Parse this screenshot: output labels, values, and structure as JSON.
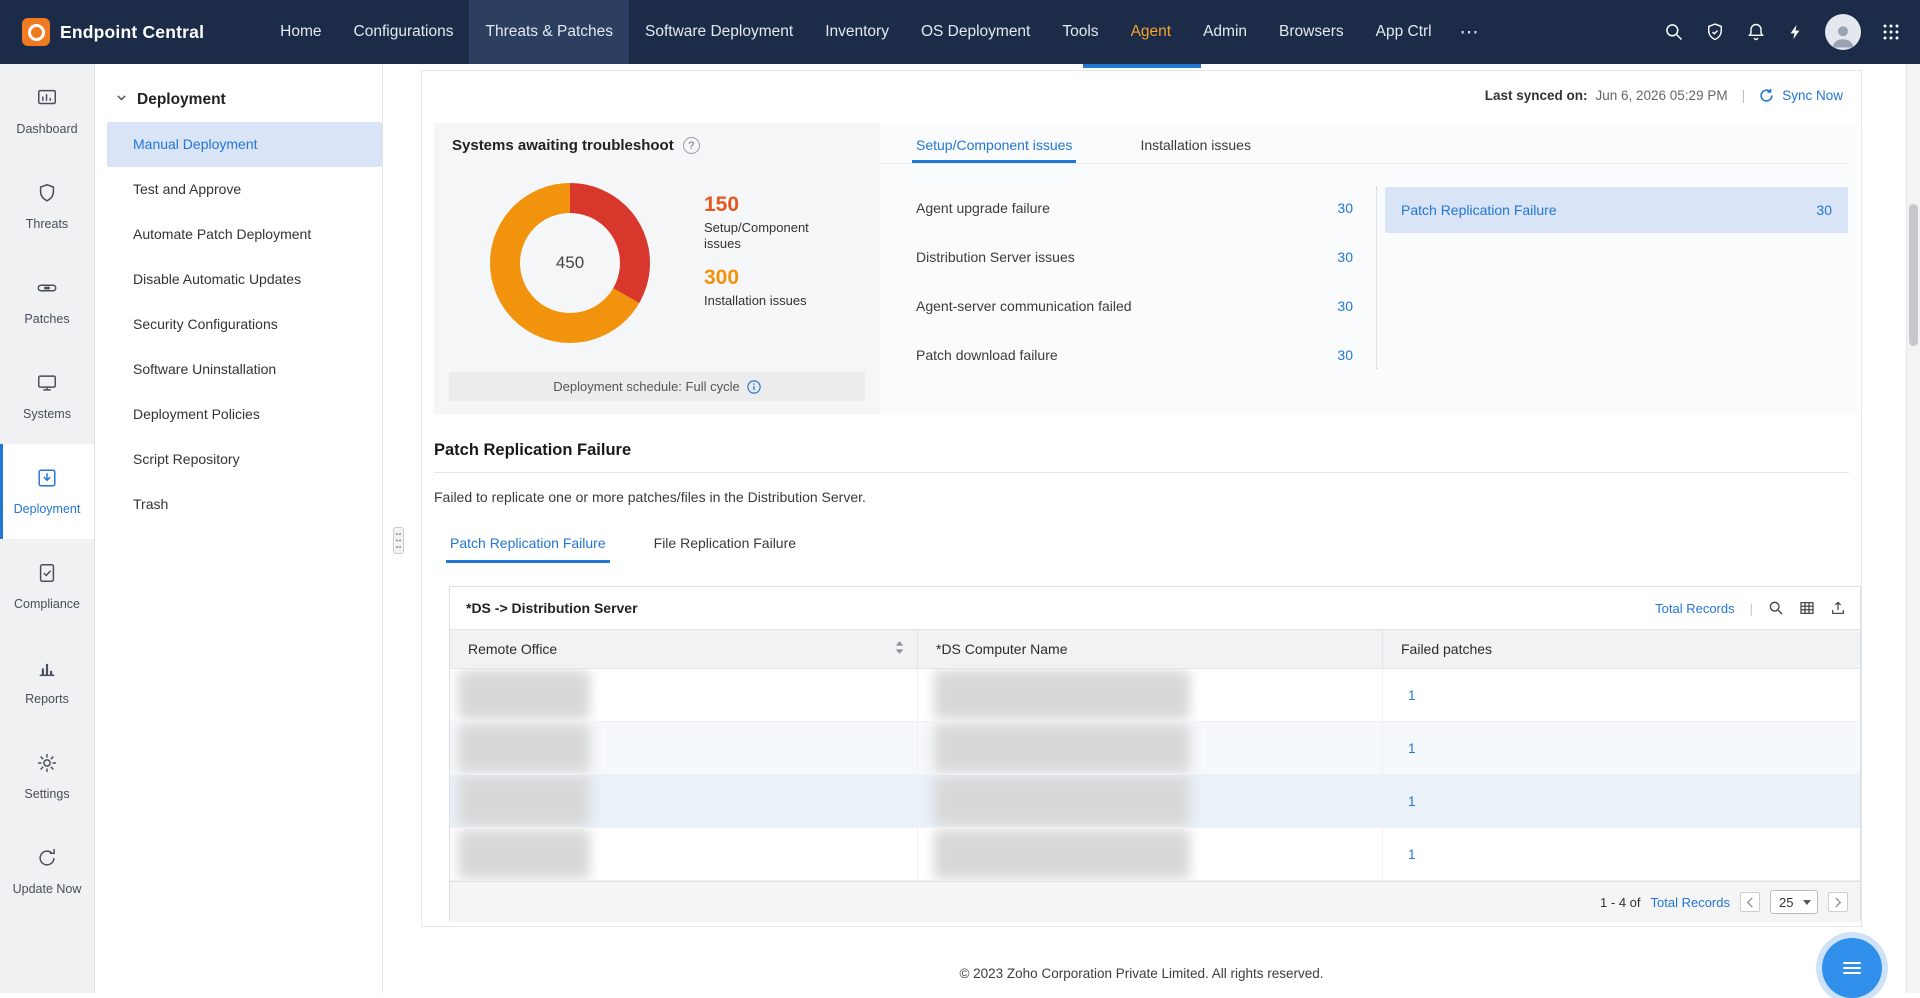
{
  "colors": {
    "navbar_bg": "#1c2b48",
    "accent_blue": "#2276d4",
    "agent_orange": "#f6a22d",
    "brand_logo_orange": "#f07b22",
    "donut_red": "#d8372c",
    "donut_orange": "#f2930e",
    "count_red": "#e4571e",
    "selected_bg": "#d9e5f7"
  },
  "navbar": {
    "brand": "Endpoint Central",
    "items": [
      "Home",
      "Configurations",
      "Threats & Patches",
      "Software Deployment",
      "Inventory",
      "OS Deployment",
      "Tools",
      "Agent",
      "Admin",
      "Browsers",
      "App Ctrl",
      "⋯"
    ]
  },
  "sidebar": {
    "items": [
      "Dashboard",
      "Threats",
      "Patches",
      "Systems",
      "Deployment",
      "Compliance",
      "Reports",
      "Settings",
      "Update Now"
    ]
  },
  "subnav": {
    "header": "Deployment",
    "items": [
      "Manual Deployment",
      "Test and Approve",
      "Automate Patch Deployment",
      "Disable Automatic Updates",
      "Security Configurations",
      "Software Uninstallation",
      "Deployment Policies",
      "Script Repository",
      "Trash"
    ]
  },
  "sync": {
    "label": "Last synced on:",
    "value": "Jun 6, 2026 05:29 PM",
    "separator": "|",
    "action": "Sync Now"
  },
  "troubleshoot": {
    "title": "Systems awaiting troubleshoot",
    "help": "?",
    "total": "450",
    "stats": [
      {
        "count": "150",
        "label": "Setup/Component issues"
      },
      {
        "count": "300",
        "label": "Installation issues"
      }
    ],
    "schedule_label": "Deployment schedule: Full cycle"
  },
  "issue_tabs": [
    "Setup/Component issues",
    "Installation issues"
  ],
  "issues": [
    {
      "label": "Agent upgrade failure",
      "count": "30"
    },
    {
      "label": "Distribution Server issues",
      "count": "30"
    },
    {
      "label": "Agent-server communication failed",
      "count": "30"
    },
    {
      "label": "Patch download failure",
      "count": "30"
    }
  ],
  "selected_issue": {
    "label": "Patch Replication Failure",
    "count": "30"
  },
  "detail": {
    "title": "Patch Replication Failure",
    "description": "Failed to replicate one or more patches/files in the Distribution Server.",
    "tabs": [
      "Patch Replication Failure",
      "File Replication Failure"
    ]
  },
  "table": {
    "caption": "*DS -> Distribution Server",
    "total_records": "Total Records",
    "separator": "|",
    "columns": [
      "Remote Office",
      "*DS Computer Name",
      "Failed patches"
    ],
    "rows": [
      {
        "failed": "1"
      },
      {
        "failed": "1"
      },
      {
        "failed": "1"
      },
      {
        "failed": "1"
      }
    ],
    "pagination": {
      "range": "1 - 4 of",
      "total_link": "Total Records",
      "page_size": "25"
    }
  },
  "footer": {
    "text": "© 2023 Zoho Corporation Private Limited.  All rights reserved."
  },
  "chart_data": {
    "type": "pie",
    "title": "Systems awaiting troubleshoot",
    "labels": [
      "Setup/Component issues",
      "Installation issues"
    ],
    "values": [
      150,
      300
    ],
    "total": 450,
    "colors": [
      "#d8372c",
      "#f2930e"
    ],
    "center_label": "450"
  }
}
